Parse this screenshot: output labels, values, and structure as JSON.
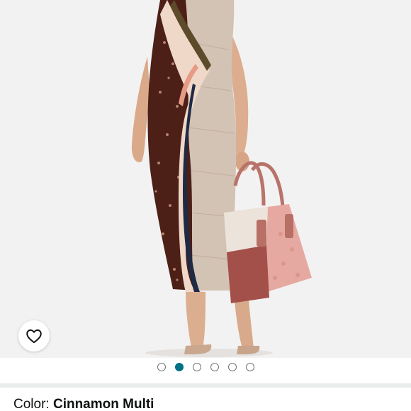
{
  "product": {
    "image_alt": "Model wearing patchwork floral and scarf-print dress holding a pink logo tote bag",
    "gallery": {
      "count": 6,
      "active_index": 1
    },
    "wishlist_icon": "heart-outline-icon"
  },
  "variation": {
    "label": "Color: ",
    "value": "Cinnamon Multi"
  },
  "colors": {
    "accent": "#007185",
    "text": "#0f1111",
    "divider": "#eaeded"
  }
}
